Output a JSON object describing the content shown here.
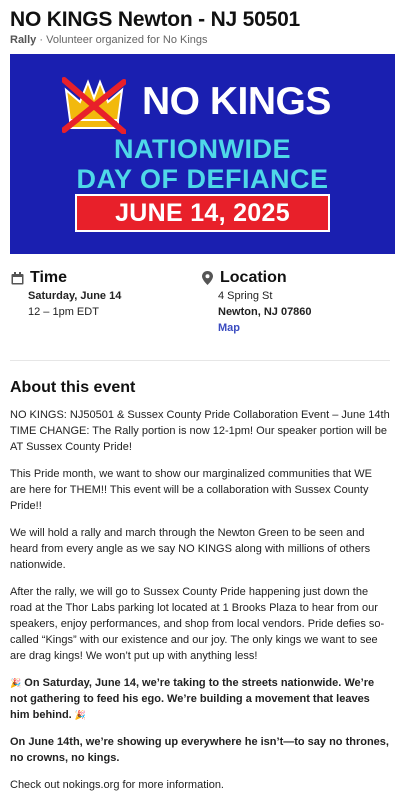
{
  "event": {
    "title": "NO KINGS Newton - NJ 50501",
    "kind": "Rally",
    "organizer": "Volunteer organized for No Kings"
  },
  "banner": {
    "headline": "NO KINGS",
    "line1": "NATIONWIDE",
    "line2": "DAY OF DEFIANCE",
    "date": "JUNE 14, 2025",
    "colors": {
      "background": "#1a1fb0",
      "accent_text": "#4fd8e8",
      "date_box": "#e8202a",
      "crown": "#f2b90d",
      "strike": "#e8202a"
    }
  },
  "time": {
    "heading": "Time",
    "date": "Saturday, June 14",
    "hours": "12 – 1pm EDT",
    "icon": "calendar-icon"
  },
  "location": {
    "heading": "Location",
    "street": "4 Spring St",
    "city": "Newton, NJ 07860",
    "map_link": "Map",
    "icon": "map-pin-icon"
  },
  "about": {
    "heading": "About this event",
    "paragraphs": [
      "NO KINGS: NJ50501 & Sussex County Pride Collaboration Event – June 14th TIME CHANGE: The Rally portion is now 12-1pm! Our speaker portion will be AT Sussex County Pride!",
      "This Pride month, we want to show our marginalized communities that WE are here for THEM!! This event will be a collaboration with Sussex County Pride!!",
      "We will hold a rally and march through the Newton Green to be seen and heard from every angle as we say NO KINGS along with millions of others nationwide.",
      "After the rally, we will go to Sussex County Pride happening just down the road at the Thor Labs parking lot located at 1 Brooks Plaza to hear from our speakers, enjoy performances, and shop from local vendors. Pride defies so-called “Kings” with our existence and our joy. The only kings we want to see are drag kings! We won’t put up with anything less!",
      "On Saturday, June 14, we’re taking to the streets nationwide. We’re not gathering to feed his ego. We’re building a movement that leaves him behind.",
      "On June 14th, we’re showing up everywhere he isn’t—to say no thrones, no crowns, no kings.",
      "Check out nokings.org for more information."
    ],
    "emoji": "🎉"
  }
}
